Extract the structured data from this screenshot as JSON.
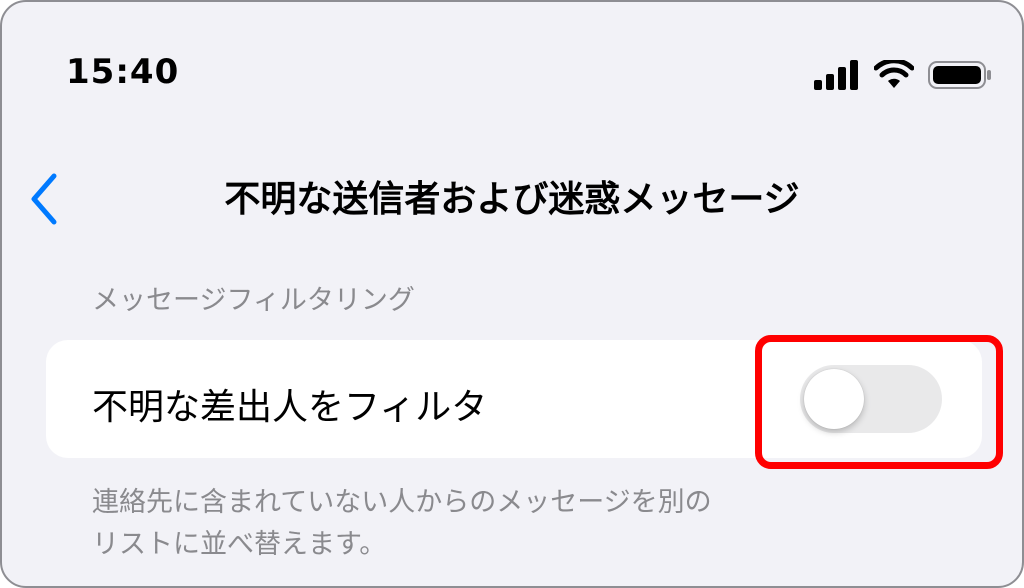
{
  "status_bar": {
    "time": "15:40",
    "signal_icon": "cellular-signal-icon",
    "wifi_icon": "wifi-icon",
    "battery_icon": "battery-icon"
  },
  "nav": {
    "back_icon": "chevron-left-icon",
    "title": "不明な送信者および迷惑メッセージ"
  },
  "section": {
    "header": "メッセージフィルタリング",
    "row_label": "不明な差出人をフィルタ",
    "toggle_on": false,
    "footer_line1": "連絡先に含まれていない人からのメッセージを別の",
    "footer_line2": "リストに並べ替えます。"
  },
  "colors": {
    "accent": "#007aff",
    "highlight": "#ff0000",
    "background": "#f2f2f7",
    "secondary_text": "#8a8a8e"
  }
}
